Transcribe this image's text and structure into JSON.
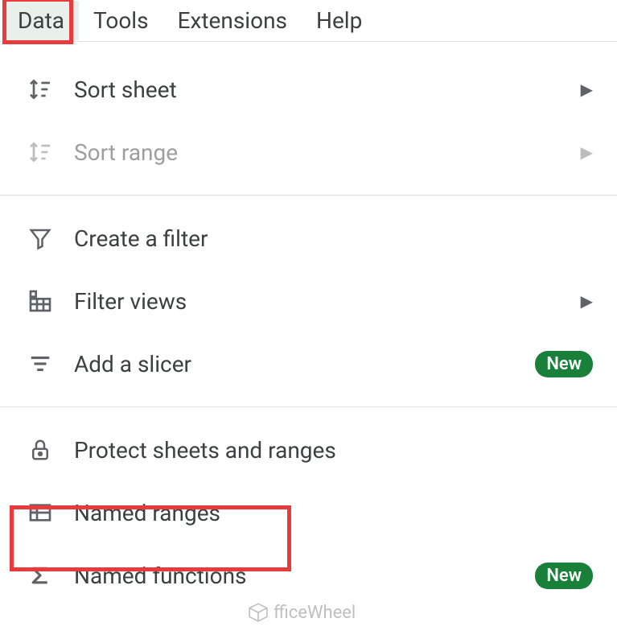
{
  "menubar": {
    "items": [
      "Data",
      "Tools",
      "Extensions",
      "Help"
    ]
  },
  "dropdown": {
    "sort_sheet": "Sort sheet",
    "sort_range": "Sort range",
    "create_filter": "Create a filter",
    "filter_views": "Filter views",
    "add_slicer": "Add a slicer",
    "protect": "Protect sheets and ranges",
    "named_ranges": "Named ranges",
    "named_functions": "Named functions"
  },
  "badges": {
    "new": "New"
  },
  "watermark": "fficeWheel"
}
